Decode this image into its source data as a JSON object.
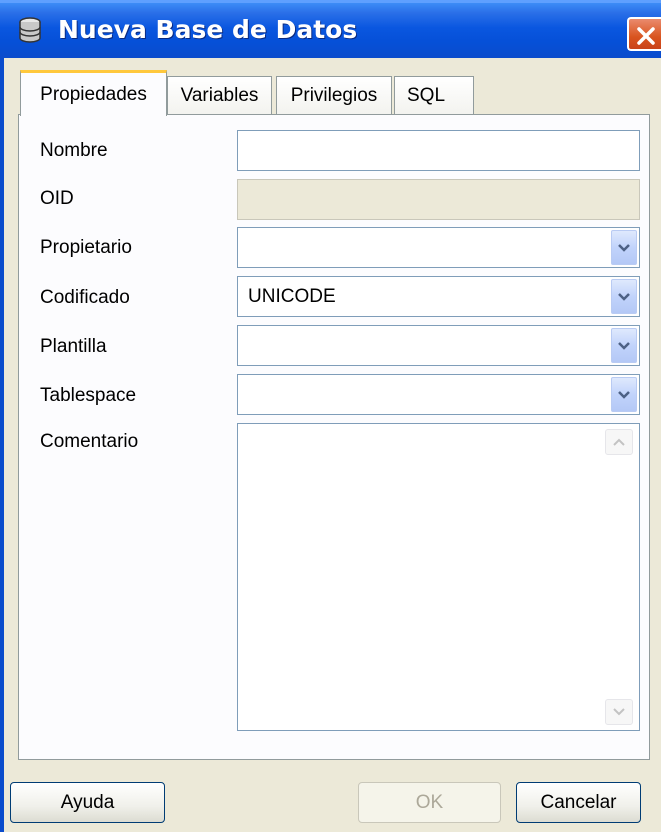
{
  "window": {
    "title": "Nueva Base de Datos",
    "icon": "database-icon",
    "close_icon": "close-icon"
  },
  "tabs": [
    {
      "label": "Propiedades",
      "active": true
    },
    {
      "label": "Variables",
      "active": false
    },
    {
      "label": "Privilegios",
      "active": false
    },
    {
      "label": "SQL",
      "active": false
    }
  ],
  "form": {
    "nombre": {
      "label": "Nombre",
      "value": ""
    },
    "oid": {
      "label": "OID",
      "value": ""
    },
    "propietario": {
      "label": "Propietario",
      "value": ""
    },
    "codificado": {
      "label": "Codificado",
      "value": "UNICODE"
    },
    "plantilla": {
      "label": "Plantilla",
      "value": ""
    },
    "tablespace": {
      "label": "Tablespace",
      "value": ""
    },
    "comentario": {
      "label": "Comentario",
      "value": ""
    }
  },
  "buttons": {
    "help": "Ayuda",
    "ok": "OK",
    "cancel": "Cancelar"
  },
  "colors": {
    "titlebar": "#0a57e0",
    "tab_highlight": "#ffc83c",
    "dialog_bg": "#ece9d8"
  }
}
